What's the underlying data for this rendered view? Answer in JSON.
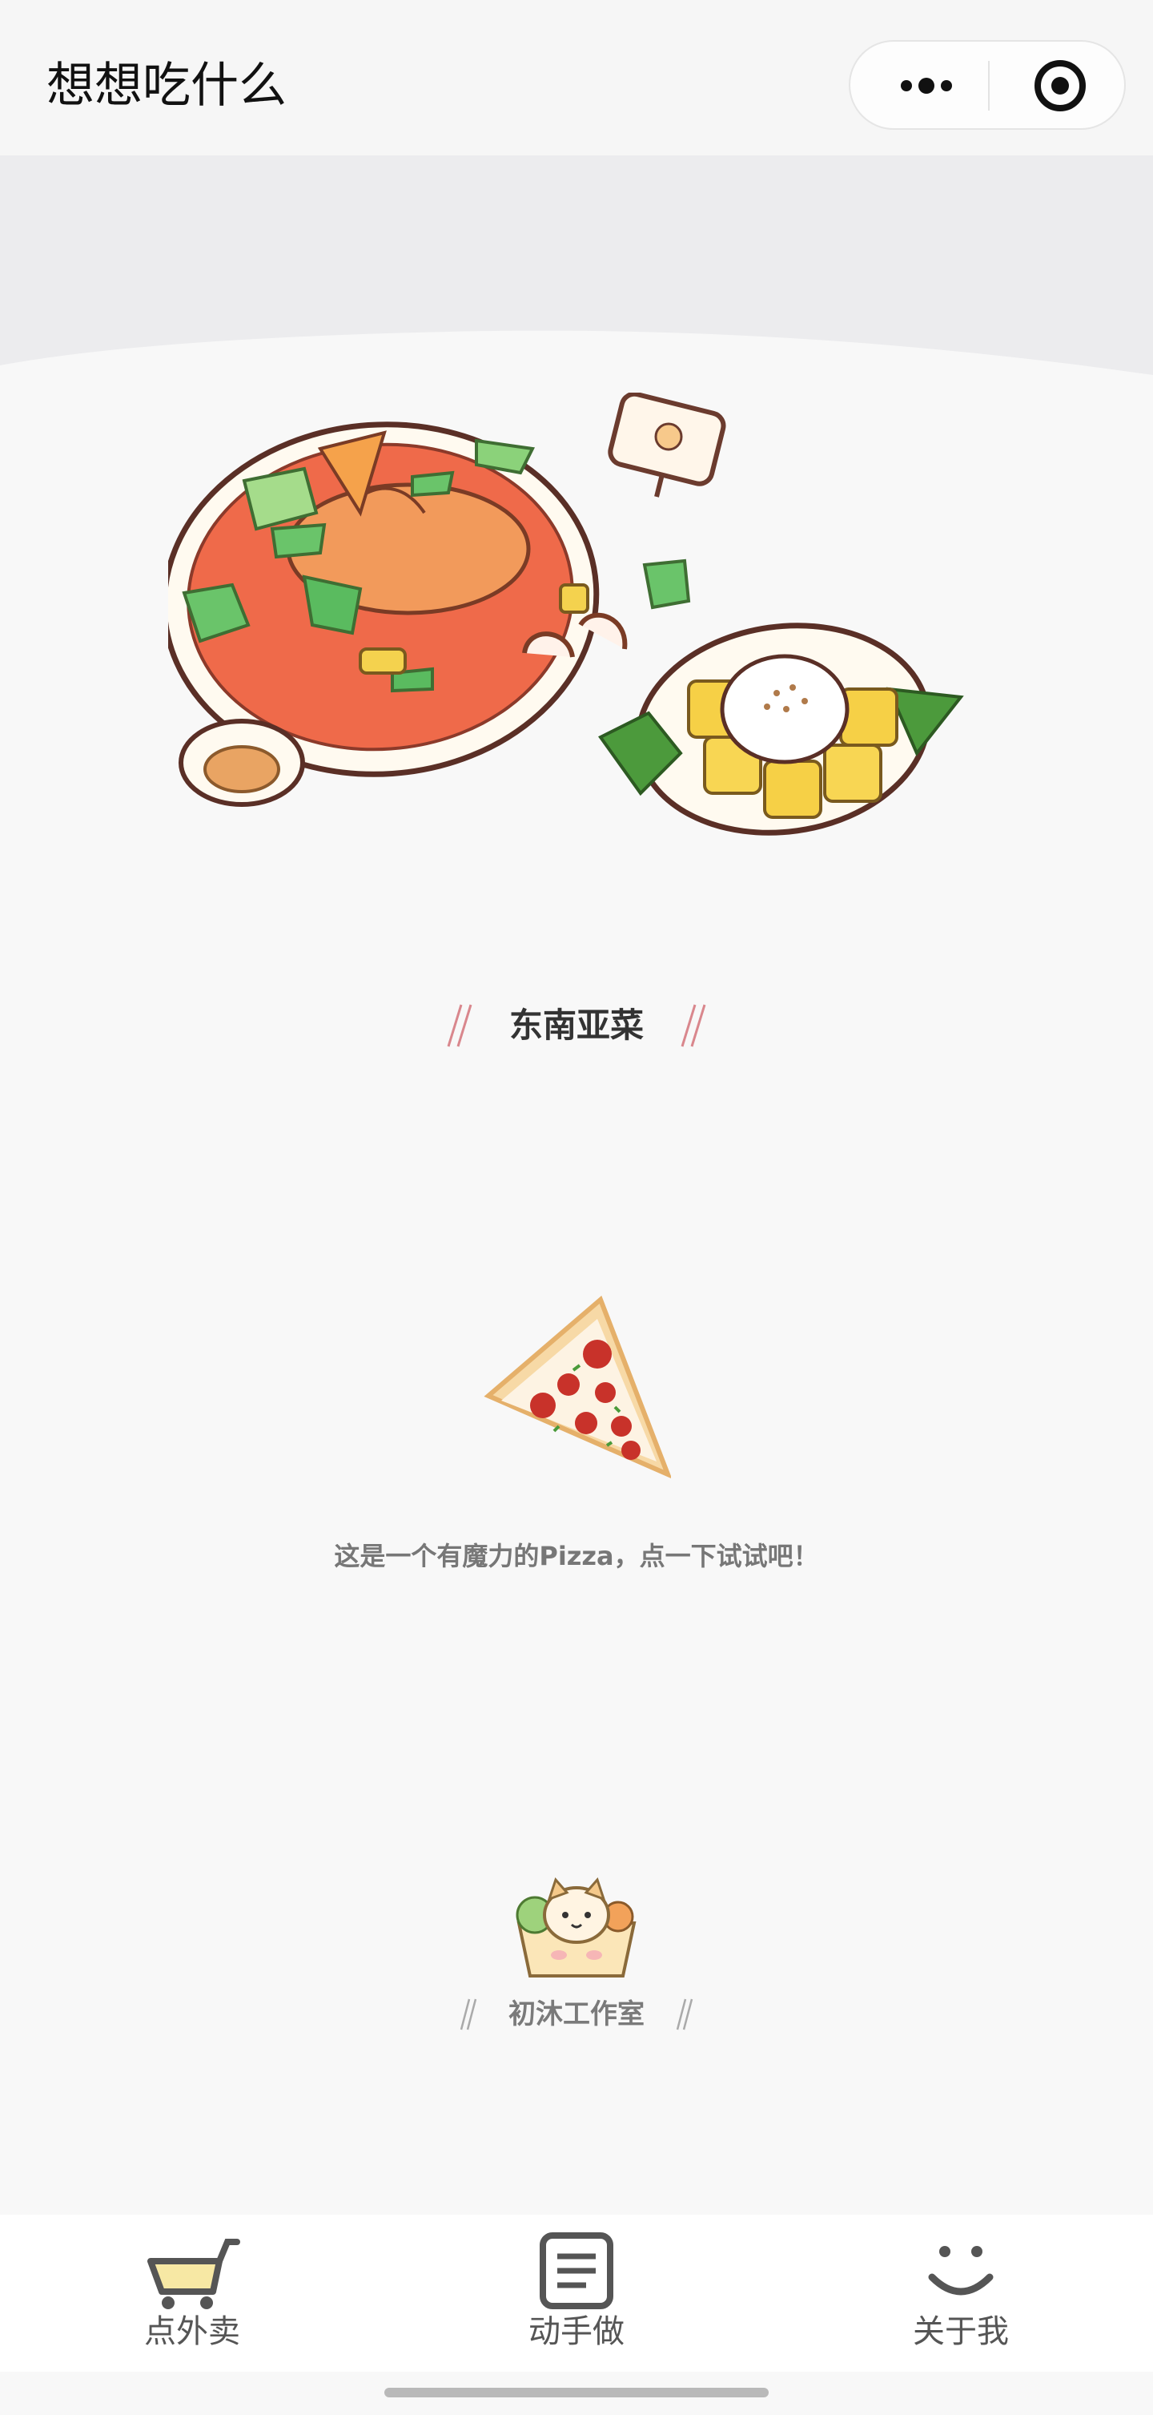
{
  "navbar": {
    "title": "想想吃什么",
    "more_icon": "more-dots-icon",
    "close_icon": "target-circle-icon"
  },
  "hero": {
    "image": "southeast-asian-food-illustration"
  },
  "section": {
    "title": "东南亚菜"
  },
  "pizza": {
    "icon": "pizza-slice-icon",
    "hint": "这是一个有魔力的Pizza，点一下试试吧！"
  },
  "studio": {
    "logo": "cat-in-basket-logo",
    "name": "初沐工作室"
  },
  "tabbar": {
    "items": [
      {
        "label": "点外卖",
        "icon": "cart-icon"
      },
      {
        "label": "动手做",
        "icon": "document-icon"
      },
      {
        "label": "关于我",
        "icon": "smile-icon"
      }
    ]
  },
  "colors": {
    "accent_slash": "#d9878d",
    "background": "#f8f8f8",
    "header_bg": "#f6f6f6",
    "wave_bg": "#ececee"
  }
}
